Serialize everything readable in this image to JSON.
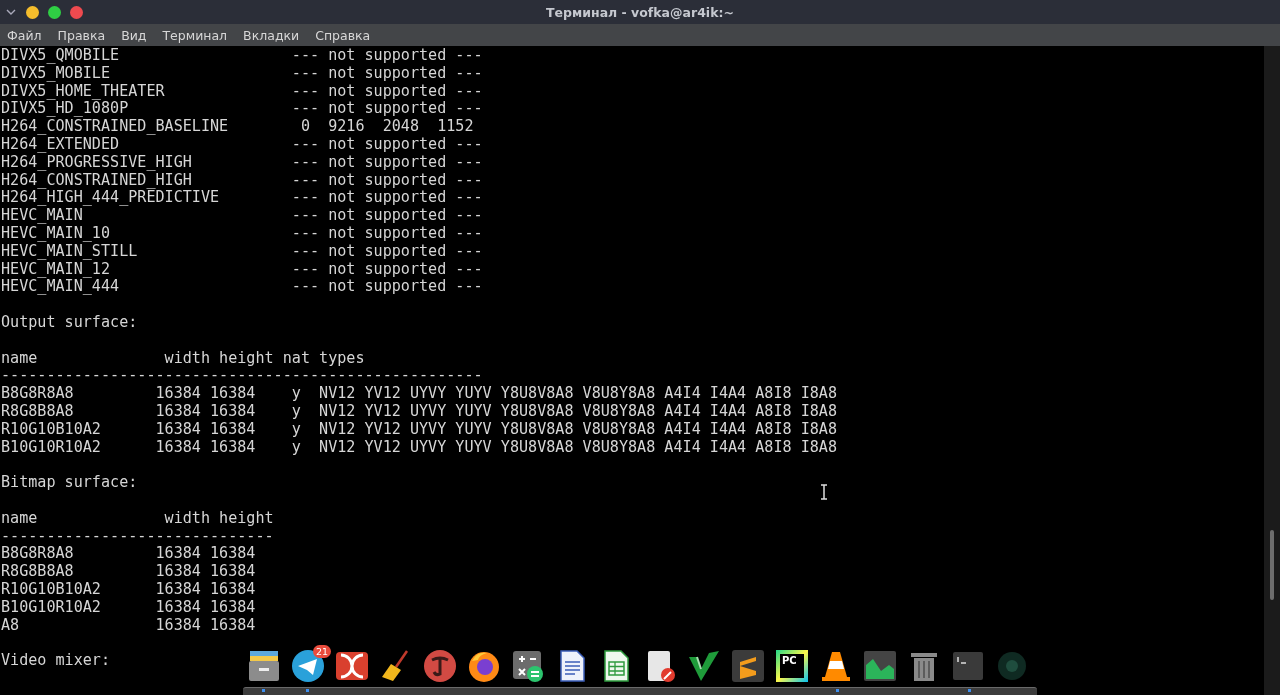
{
  "window": {
    "title": "Терминал - vofka@ar4ik:~"
  },
  "menu": [
    "Файл",
    "Правка",
    "Вид",
    "Терминал",
    "Вкладки",
    "Справка"
  ],
  "terminal": {
    "blocks": [
      [
        "DIVX5_QMOBILE                   --- not supported ---",
        "DIVX5_MOBILE                    --- not supported ---",
        "DIVX5_HOME_THEATER              --- not supported ---",
        "DIVX5_HD_1080P                  --- not supported ---",
        "H264_CONSTRAINED_BASELINE        0  9216  2048  1152",
        "H264_EXTENDED                   --- not supported ---",
        "H264_PROGRESSIVE_HIGH           --- not supported ---",
        "H264_CONSTRAINED_HIGH           --- not supported ---",
        "H264_HIGH_444_PREDICTIVE        --- not supported ---",
        "HEVC_MAIN                       --- not supported ---",
        "HEVC_MAIN_10                    --- not supported ---",
        "HEVC_MAIN_STILL                 --- not supported ---",
        "HEVC_MAIN_12                    --- not supported ---",
        "HEVC_MAIN_444                   --- not supported ---"
      ],
      [
        "Output surface:"
      ],
      [
        "name              width height nat types",
        "-----------------------------------------------------",
        "B8G8R8A8         16384 16384    y  NV12 YV12 UYVY YUYV Y8U8V8A8 V8U8Y8A8 A4I4 I4A4 A8I8 I8A8",
        "R8G8B8A8         16384 16384    y  NV12 YV12 UYVY YUYV Y8U8V8A8 V8U8Y8A8 A4I4 I4A4 A8I8 I8A8",
        "R10G10B10A2      16384 16384    y  NV12 YV12 UYVY YUYV Y8U8V8A8 V8U8Y8A8 A4I4 I4A4 A8I8 I8A8",
        "B10G10R10A2      16384 16384    y  NV12 YV12 UYVY YUYV Y8U8V8A8 V8U8Y8A8 A4I4 I4A4 A8I8 I8A8"
      ],
      [
        "Bitmap surface:"
      ],
      [
        "name              width height",
        "------------------------------",
        "B8G8R8A8         16384 16384",
        "R8G8B8A8         16384 16384",
        "R10G10B10A2      16384 16384",
        "B10G10R10A2      16384 16384",
        "A8               16384 16384"
      ],
      [
        "Video mixer:"
      ]
    ]
  },
  "dock": {
    "badge": "21",
    "logo_text": "PC"
  }
}
